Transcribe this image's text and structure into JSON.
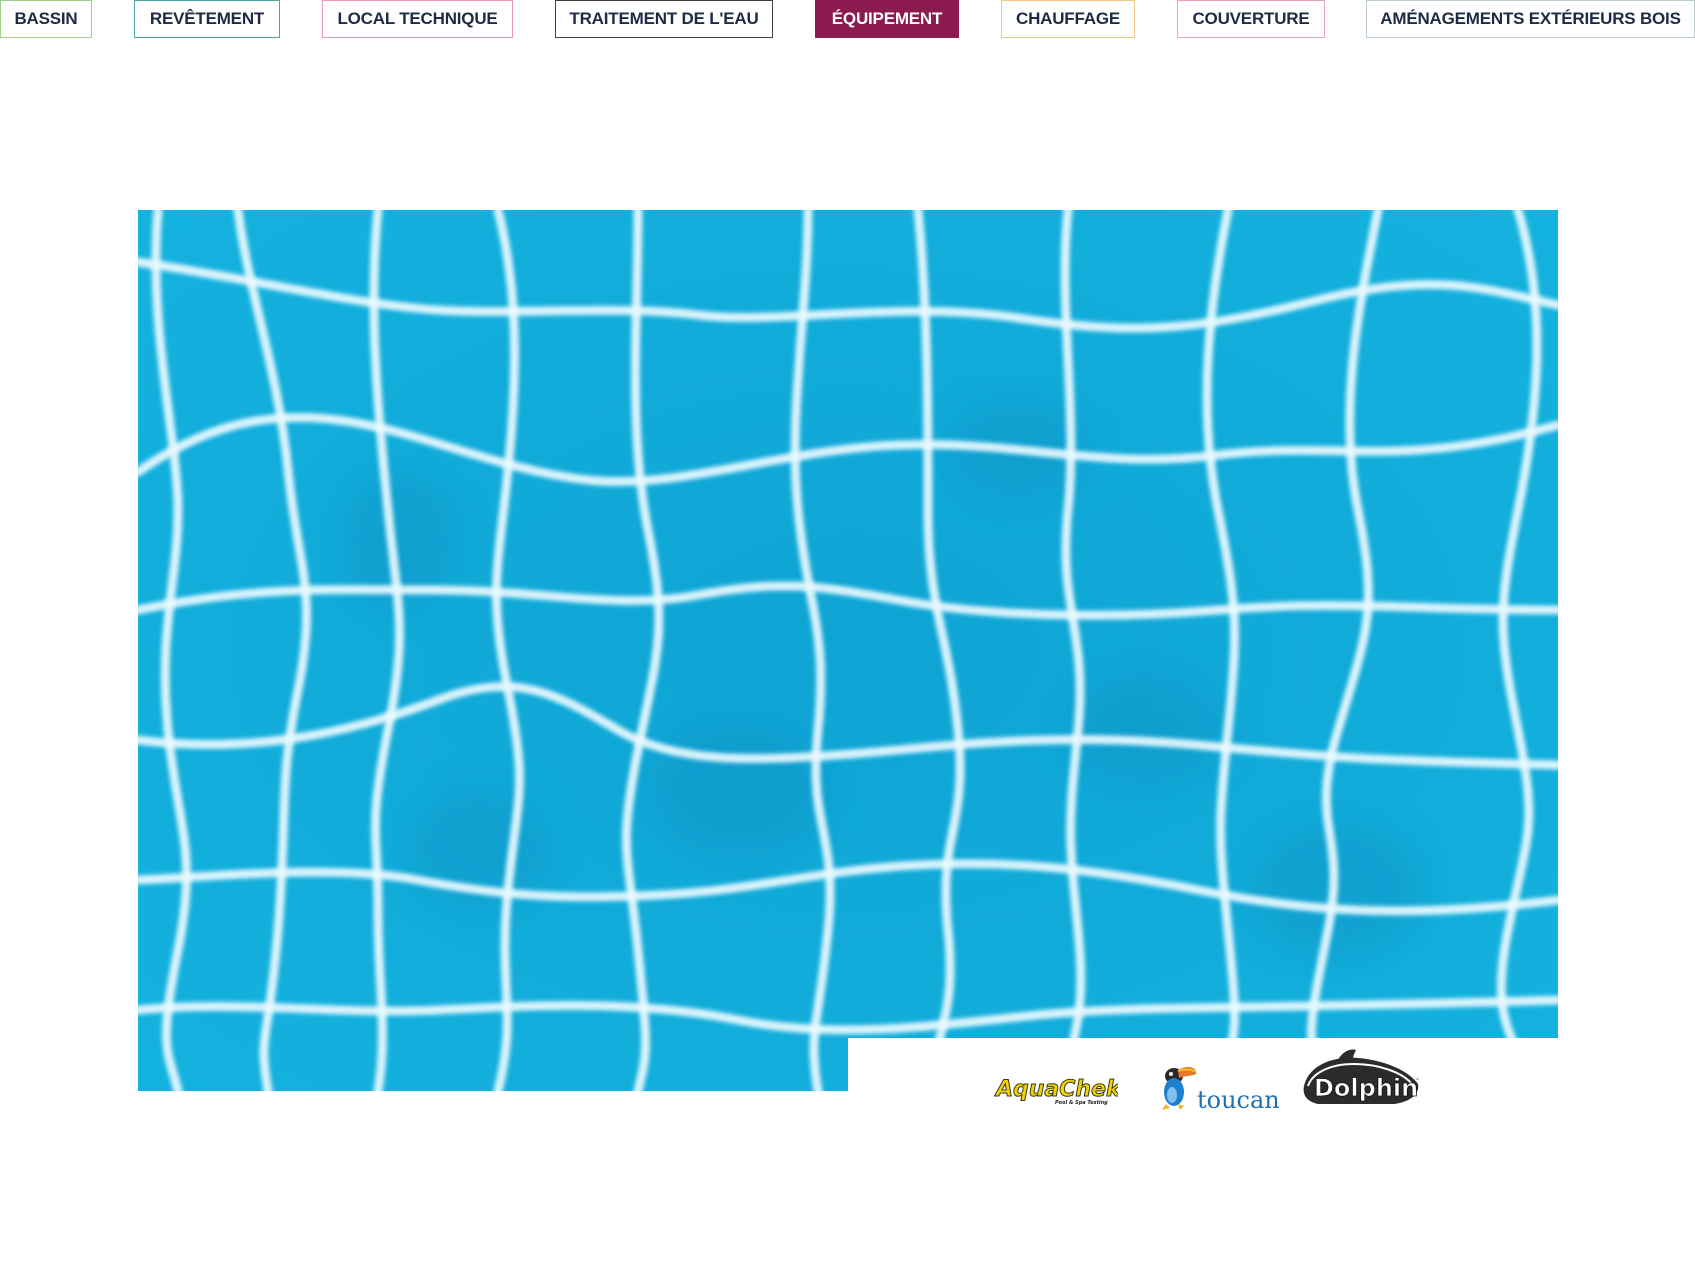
{
  "nav": {
    "tabs": [
      {
        "label": "BASSIN",
        "border": "#9fd08a",
        "active": false
      },
      {
        "label": "REVÊTEMENT",
        "border": "#4fa3a5",
        "active": false
      },
      {
        "label": "LOCAL TECHNIQUE",
        "border": "#e79bb0",
        "active": false
      },
      {
        "label": "TRAITEMENT DE L'EAU",
        "border": "#3a3f4b",
        "active": false
      },
      {
        "label": "ÉQUIPEMENT",
        "border": "#8b1a4e",
        "active": true
      },
      {
        "label": "CHAUFFAGE",
        "border": "#f2c88a",
        "active": false
      },
      {
        "label": "COUVERTURE",
        "border": "#e7a4b8",
        "active": false
      },
      {
        "label": "AMÉNAGEMENTS EXTÉRIEURS BOIS",
        "border": "#b8cfc0",
        "active": false
      }
    ],
    "active_color": "#8b1a4e",
    "text_color": "#1f2a44"
  },
  "hero": {
    "image": "pool-tiles-underwater",
    "water_color": "#12aedb"
  },
  "brands": {
    "logos": [
      {
        "name": "AquaChek",
        "tagline": "Pool & Spa Testing",
        "icon": "aquachek-logo"
      },
      {
        "name": "toucan",
        "icon": "toucan-logo"
      },
      {
        "name": "Dolphin",
        "icon": "dolphin-logo"
      }
    ]
  }
}
